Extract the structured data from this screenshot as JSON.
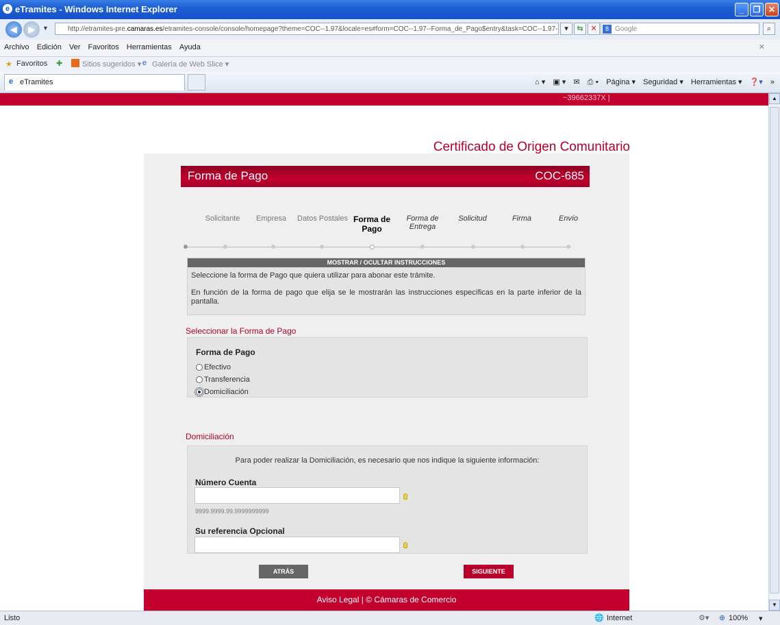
{
  "window": {
    "title": "eTramites - Windows Internet Explorer",
    "address_prefix": "http://etramites-pre.",
    "address_domain": "camaras.es",
    "address_rest": "/etramites-console/console/homepage?theme=COC--1.97&locale=es#form=COC--1.97--Forma_de_Pago$entry&task=COC--1.97--(",
    "search_placeholder": "Google"
  },
  "menu": [
    "Archivo",
    "Edición",
    "Ver",
    "Favoritos",
    "Herramientas",
    "Ayuda"
  ],
  "favorites": {
    "label": "Favoritos",
    "items": [
      "Sitios sugeridos ▾",
      "Galería de Web Slice ▾"
    ]
  },
  "tab": {
    "label": "eTramites"
  },
  "commandbar": [
    "Página ▾",
    "Seguridad ▾",
    "Herramientas ▾"
  ],
  "page": {
    "user_fragment": "~39662337X |",
    "doc_title": "Certificado de Origen Comunitario",
    "header_title": "Forma de Pago",
    "header_code": "COC-685",
    "steps": [
      {
        "label": "Solicitante",
        "state": "done"
      },
      {
        "label": "Empresa",
        "state": "done"
      },
      {
        "label": "Datos Postales",
        "state": "done"
      },
      {
        "label": "Forma de Pago",
        "state": "current"
      },
      {
        "label": "Forma de Entrega",
        "state": "future"
      },
      {
        "label": "Solicitud",
        "state": "future"
      },
      {
        "label": "Firma",
        "state": "future"
      },
      {
        "label": "Envío",
        "state": "future"
      }
    ],
    "instructions": {
      "toggle": "MOSTRAR / OCULTAR INSTRUCCIONES",
      "p1": "Seleccione la forma de Pago que quiera utilizar para abonar este trámite.",
      "p2": "En función de la forma de pago que elija se le mostrarán las instrucciones específicas en la parte inferior de la pantalla."
    },
    "payment": {
      "section_title": "Seleccionar la Forma de Pago",
      "label": "Forma de Pago",
      "options": [
        "Efectivo",
        "Transferencia",
        "Domiciliación"
      ],
      "selected": "Domiciliación"
    },
    "domiciliacion": {
      "section_title": "Domiciliación",
      "intro": "Para poder realizar la Domiciliación, es necesario que nos indique la siguiente información:",
      "account_label": "Número Cuenta",
      "account_value": "",
      "account_hint": "9999.9999.99.9999999999",
      "ref_label": "Su referencia Opcional",
      "ref_value": ""
    },
    "buttons": {
      "back": "ATRÁS",
      "next": "SIGUIENTE"
    },
    "footer": "Aviso Legal | © Cámaras de Comercio"
  },
  "status": {
    "left": "Listo",
    "zone": "Internet",
    "zoom": "100%"
  }
}
